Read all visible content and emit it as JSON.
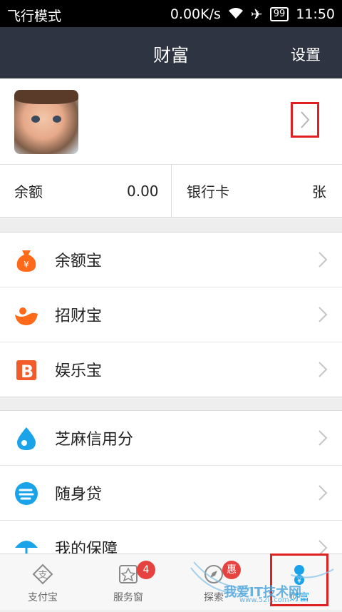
{
  "status_bar": {
    "mode": "飞行模式",
    "speed": "0.00K/s",
    "battery": "99",
    "time": "11:50"
  },
  "header": {
    "title": "财富",
    "settings_label": "设置"
  },
  "balance": {
    "label": "余额",
    "value": "0.00",
    "bank_label": "银行卡",
    "bank_unit": "张"
  },
  "groups": [
    {
      "items": [
        {
          "label": "余额宝",
          "icon": "money-bag-icon",
          "color": "#ff6a1a"
        },
        {
          "label": "招财宝",
          "icon": "zhaocaibao-icon",
          "color": "#ff6a1a"
        },
        {
          "label": "娱乐宝",
          "icon": "yulebao-icon",
          "color": "#f25c2a"
        }
      ]
    },
    {
      "items": [
        {
          "label": "芝麻信用分",
          "icon": "sesame-credit-icon",
          "color": "#1aa3e8"
        },
        {
          "label": "随身贷",
          "icon": "loan-icon",
          "color": "#1aa3e8"
        },
        {
          "label": "我的保障",
          "icon": "umbrella-icon",
          "color": "#1aa3e8"
        }
      ]
    }
  ],
  "tabbar": {
    "tabs": [
      {
        "label": "支付宝",
        "icon": "alipay-icon"
      },
      {
        "label": "服务窗",
        "icon": "star-window-icon",
        "badge": "4"
      },
      {
        "label": "探索",
        "icon": "explore-icon",
        "badge": "惠"
      },
      {
        "label": "财富",
        "icon": "wealth-icon",
        "active": true
      }
    ]
  },
  "watermark": {
    "text": "我爱IT技术网",
    "url": "www.52ij.com"
  },
  "colors": {
    "nav": "#2f3443",
    "accent": "#1aa3e8",
    "highlight": "#e02020"
  }
}
